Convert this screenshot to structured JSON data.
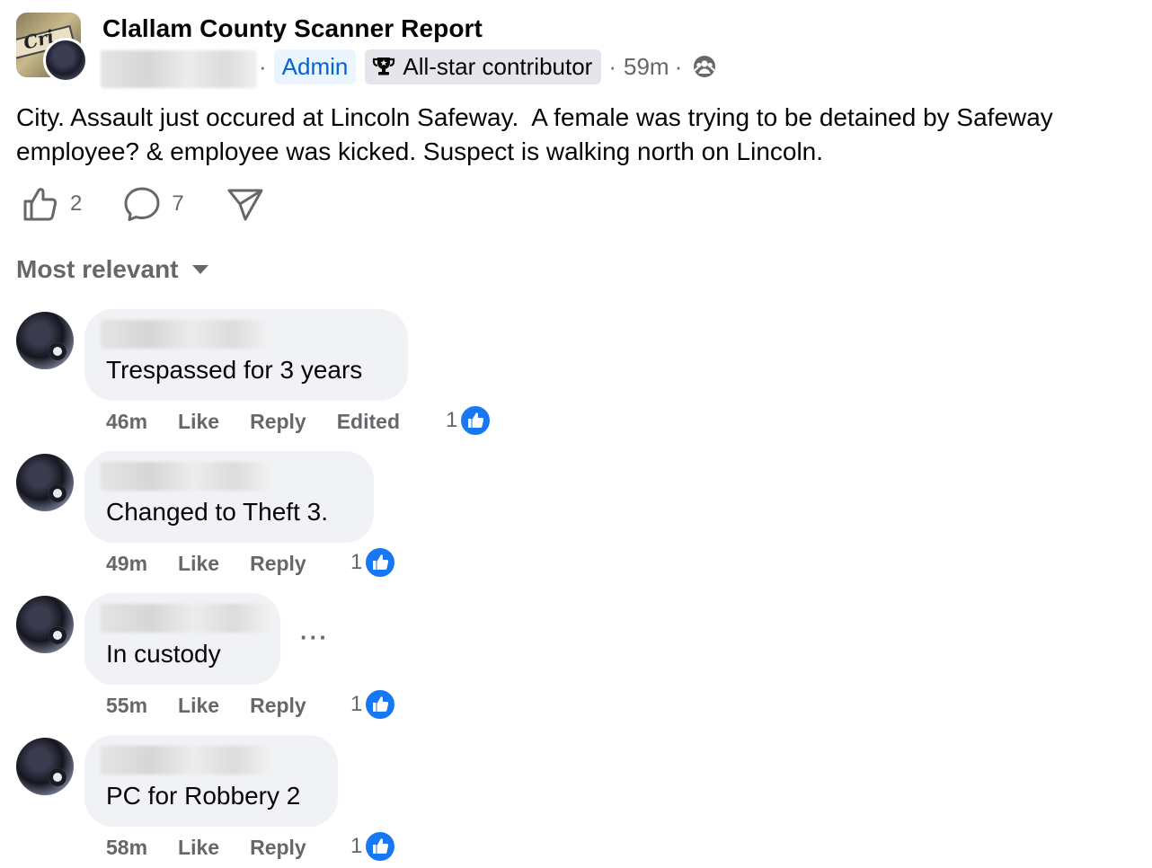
{
  "post": {
    "group_name": "Clallam County Scanner Report",
    "admin_label": "Admin",
    "badge_label": "All-star contributor",
    "time": "59m",
    "separator": "·",
    "text": "City. Assault just occured at Lincoln Safeway.  A female was trying to be detained by Safeway\nemployee? & employee was kicked. Suspect is walking north on Lincoln.",
    "like_count": "2",
    "comment_count": "7",
    "icons": {
      "like": "thumbs-up-icon",
      "comment": "comment-bubble-icon",
      "share": "share-arrow-icon",
      "audience": "group-audience-icon",
      "badge": "trophy-icon"
    }
  },
  "sort": {
    "label": "Most relevant"
  },
  "comments": [
    {
      "text": "Trespassed for 3 years",
      "time": "46m",
      "like": "Like",
      "reply": "Reply",
      "edited": "Edited",
      "reactions": "1"
    },
    {
      "text": "Changed to Theft 3.",
      "time": "49m",
      "like": "Like",
      "reply": "Reply",
      "reactions": "1"
    },
    {
      "text": "In custody",
      "time": "55m",
      "like": "Like",
      "reply": "Reply",
      "reactions": "1",
      "more": "···"
    },
    {
      "text": "PC for Robbery 2",
      "time": "58m",
      "like": "Like",
      "reply": "Reply",
      "reactions": "1"
    }
  ],
  "colors": {
    "accent": "#1877f2",
    "admin_text": "#0064d1",
    "admin_bg": "#ebf5ff",
    "bubble": "#f0f2f5",
    "muted": "#65676b"
  }
}
